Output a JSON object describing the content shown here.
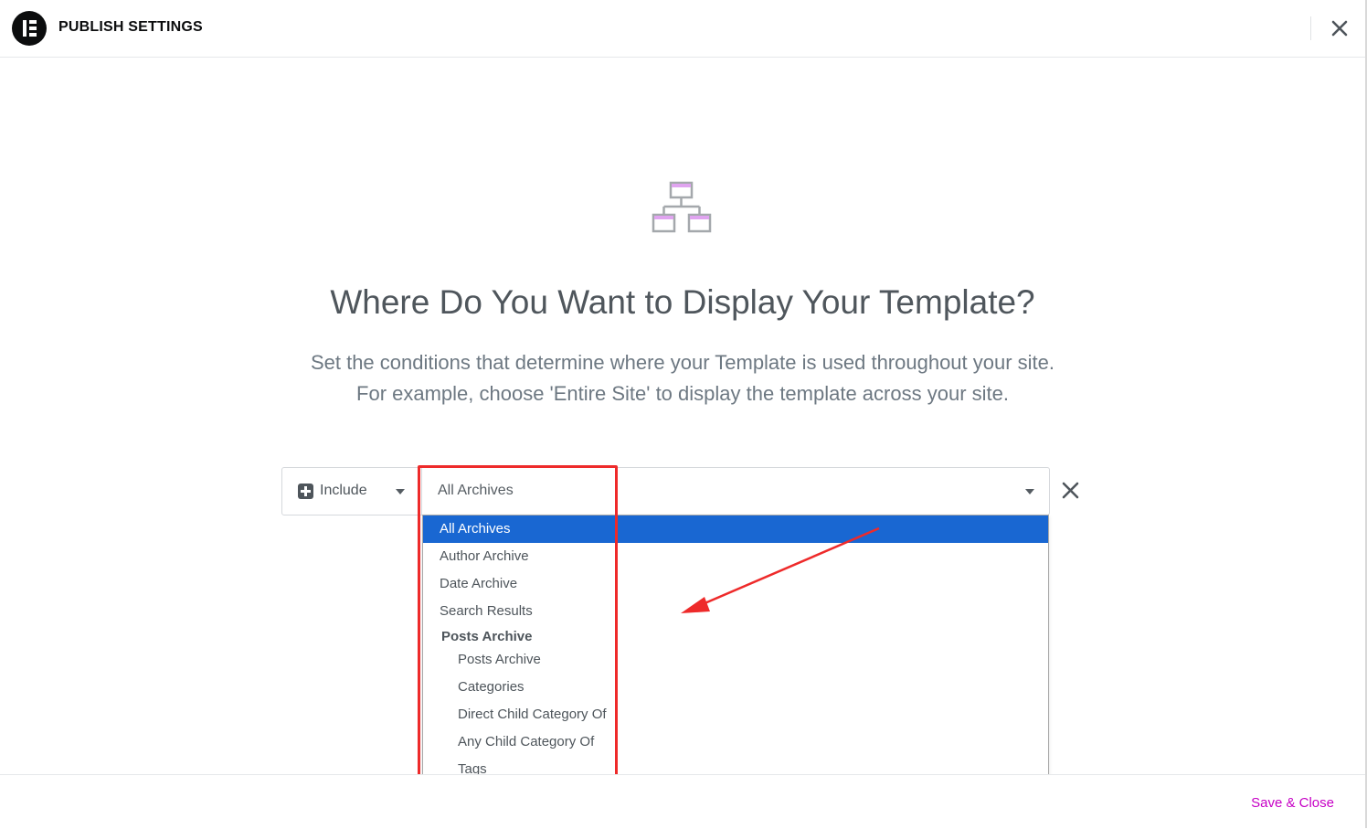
{
  "header": {
    "title": "PUBLISH SETTINGS",
    "close_icon": "close-icon",
    "logo_icon": "elementor-logo"
  },
  "hero": {
    "icon": "sitemap-icon",
    "title": "Where Do You Want to Display Your Template?",
    "subtitle_line1": "Set the conditions that determine where your Template is used throughout your site.",
    "subtitle_line2": "For example, choose 'Entire Site' to display the template across your site."
  },
  "condition": {
    "type_label": "Include",
    "type_icon": "plus-square-icon",
    "selected_value": "All Archives",
    "remove_icon": "close-icon"
  },
  "dropdown": {
    "options": [
      "All Archives",
      "Author Archive",
      "Date Archive",
      "Search Results"
    ],
    "group_label": "Posts Archive",
    "group_options": [
      "Posts Archive",
      "Categories",
      "Direct Child Category Of",
      "Any Child Category Of",
      "Tags"
    ],
    "selected_index": 0,
    "selected_color": "#1967d2"
  },
  "footer": {
    "save_label": "Save & Close",
    "save_color": "#c600c5"
  },
  "annotations": {
    "highlight_color": "#ee2a2a"
  }
}
